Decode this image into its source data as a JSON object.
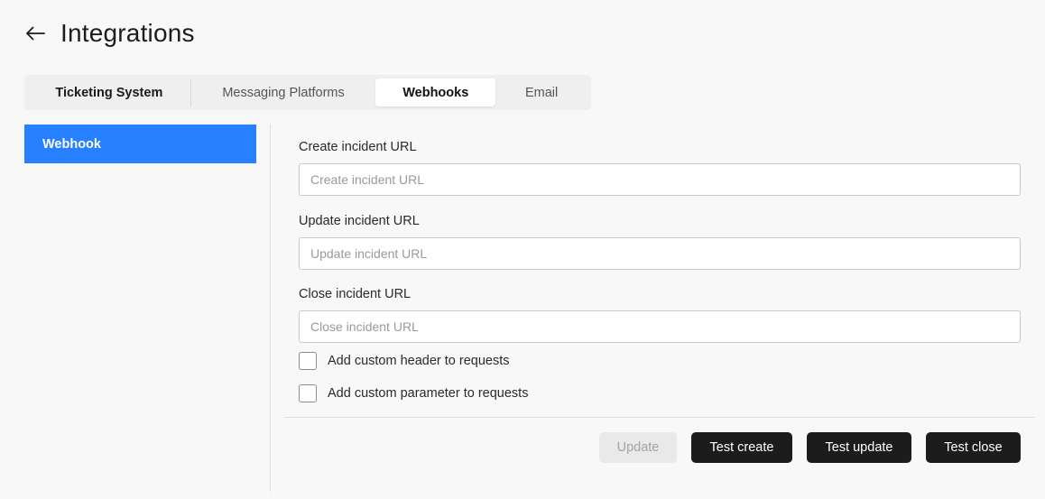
{
  "header": {
    "back_icon": "arrow-left-icon",
    "title": "Integrations"
  },
  "tabs": [
    {
      "label": "Ticketing System"
    },
    {
      "label": "Messaging Platforms"
    },
    {
      "label": "Webhooks",
      "active": true
    },
    {
      "label": "Email"
    }
  ],
  "sidebar": {
    "items": [
      {
        "label": "Webhook",
        "active": true
      }
    ]
  },
  "form": {
    "create": {
      "label": "Create incident URL",
      "placeholder": "Create incident URL",
      "value": ""
    },
    "update": {
      "label": "Update incident URL",
      "placeholder": "Update incident URL",
      "value": ""
    },
    "close": {
      "label": "Close incident URL",
      "placeholder": "Close incident URL",
      "value": ""
    },
    "custom_header": {
      "label": "Add custom header to requests",
      "checked": false
    },
    "custom_param": {
      "label": "Add custom parameter to requests",
      "checked": false
    }
  },
  "actions": {
    "update": "Update",
    "test_create": "Test create",
    "test_update": "Test update",
    "test_close": "Test close"
  },
  "colors": {
    "accent": "#2680ff",
    "dark_button": "#1c1c1c",
    "disabled_button": "#e9e9e9",
    "background": "#f8f8f8"
  }
}
